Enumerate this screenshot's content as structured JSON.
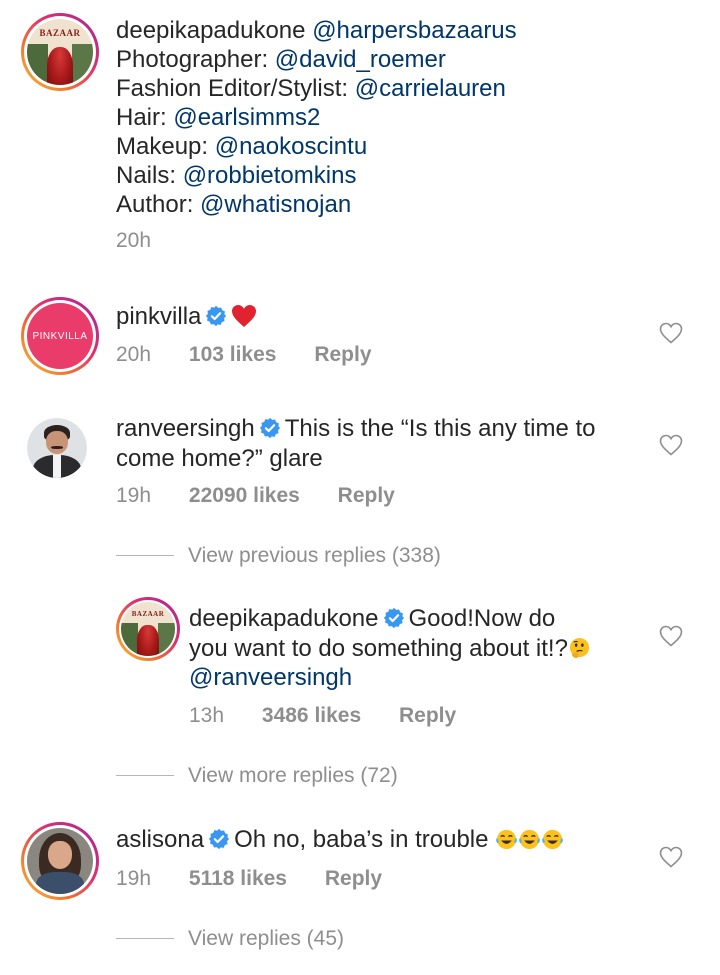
{
  "caption": {
    "username": "deepikapadukone",
    "avatar_text": "BAZAAR",
    "lines": [
      {
        "prefix": "",
        "mention": "@harpersbazaarus"
      },
      {
        "prefix": "Photographer: ",
        "mention": "@david_roemer"
      },
      {
        "prefix": "Fashion Editor/Stylist: ",
        "mention": "@carrielauren"
      },
      {
        "prefix": "Hair: ",
        "mention": "@earlsimms2"
      },
      {
        "prefix": "Makeup: ",
        "mention": "@naokoscintu"
      },
      {
        "prefix": "Nails: ",
        "mention": "@robbietomkins"
      },
      {
        "prefix": "Author: ",
        "mention": "@whatisnojan"
      }
    ],
    "time": "20h"
  },
  "comments": [
    {
      "username": "pinkvilla",
      "avatar_text": "PINKVILLA",
      "verified": true,
      "text": "",
      "emoji": "red-heart",
      "time": "20h",
      "likes": "103 likes",
      "reply": "Reply"
    },
    {
      "username": "ranveersingh",
      "verified": true,
      "text_line1": "This is the “Is this any time to",
      "text_line2": "come home?” glare",
      "time": "19h",
      "likes": "22090 likes",
      "reply": "Reply",
      "view_replies": "View previous replies (338)"
    },
    {
      "username": "deepikapadukone",
      "avatar_text": "BAZAAR",
      "verified": true,
      "text_line1": "Good!Now do",
      "text_line2": "you want to do something about it!?",
      "emoji": "thinking-face",
      "mention": "@ranveersingh",
      "time": "13h",
      "likes": "3486 likes",
      "reply": "Reply",
      "view_replies": "View more replies (72)"
    },
    {
      "username": "aslisona",
      "verified": true,
      "text": "Oh no, baba’s in trouble",
      "emoji": "tears-of-joy x3",
      "time": "19h",
      "likes": "5118 likes",
      "reply": "Reply",
      "view_replies": "View replies (45)"
    }
  ],
  "colors": {
    "text": "#262626",
    "secondary": "#8e8e8e",
    "mention": "#00376b",
    "verified": "#3897f0",
    "heart": "#ed4956"
  }
}
